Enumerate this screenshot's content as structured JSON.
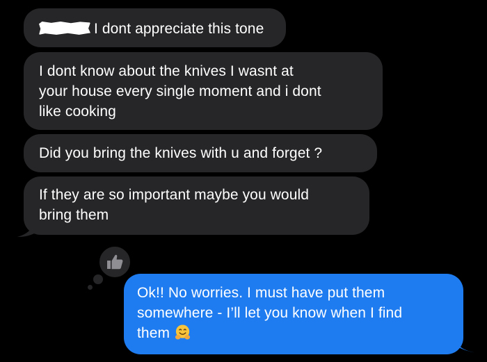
{
  "conversation": {
    "messages": [
      {
        "direction": "incoming",
        "text": "I dont appreciate this tone"
      },
      {
        "direction": "incoming",
        "text": "I dont know about the knives I wasnt at\nyour house every single moment and i dont\nlike cooking"
      },
      {
        "direction": "incoming",
        "text": "Did you bring the knives with u and forget ?"
      },
      {
        "direction": "incoming",
        "text": "If they are so important maybe you would\nbring them"
      },
      {
        "direction": "outgoing",
        "text": "Ok!! No worries. I must have put them\nsomewhere - I’ll let you know when I find\nthem",
        "emoji": "hugging-face-emoji"
      }
    ],
    "tapback": {
      "icon": "thumbs-up-icon",
      "on_message": 4
    }
  },
  "colors": {
    "background": "#000000",
    "incoming_bubble": "#262628",
    "outgoing_bubble": "#1f7cf0",
    "text": "#ffffff",
    "tapback_icon": "#8e8e93"
  }
}
